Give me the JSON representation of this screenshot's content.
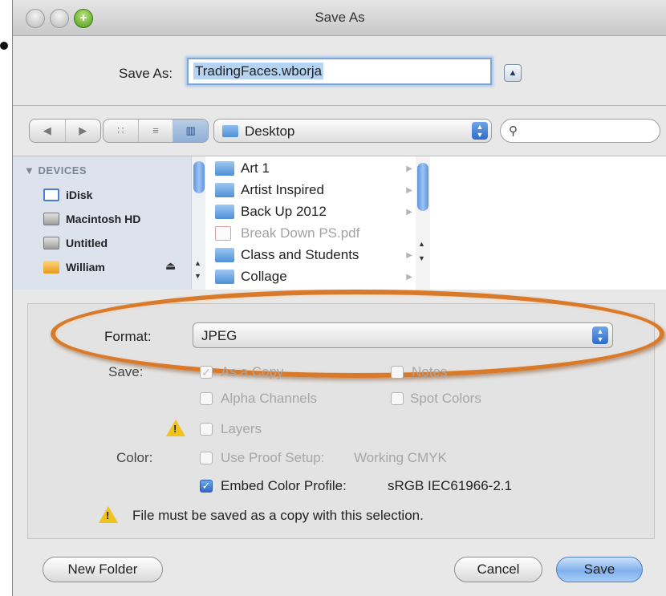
{
  "window": {
    "title": "Save As"
  },
  "save_as": {
    "label": "Save As:",
    "filename": "TradingFaces.wborja",
    "expand_glyph": "▲"
  },
  "toolbar": {
    "back_glyph": "◀",
    "forward_glyph": "▶",
    "view_icons_glyph": "∷",
    "view_list_glyph": "≡",
    "view_columns_glyph": "▥",
    "location": "Desktop",
    "search_glyph": "⚲",
    "search_value": ""
  },
  "sidebar": {
    "heading": "▼ DEVICES",
    "items": [
      {
        "label": "iDisk",
        "icon": "idisk-icon"
      },
      {
        "label": "Macintosh HD",
        "icon": "hard-drive-icon"
      },
      {
        "label": "Untitled",
        "icon": "hard-drive-icon"
      },
      {
        "label": "William",
        "icon": "home-folder-icon"
      }
    ],
    "eject_glyph": "⏏"
  },
  "files": [
    {
      "name": "Art 1",
      "type": "folder",
      "dimmed": false
    },
    {
      "name": "Artist Inspired",
      "type": "folder",
      "dimmed": false
    },
    {
      "name": "Back Up 2012",
      "type": "folder",
      "dimmed": false
    },
    {
      "name": "Break Down PS.pdf",
      "type": "pdf",
      "dimmed": true
    },
    {
      "name": "Class and Students",
      "type": "folder",
      "dimmed": false
    },
    {
      "name": "Collage",
      "type": "folder",
      "dimmed": false
    }
  ],
  "format": {
    "label": "Format:",
    "value": "JPEG",
    "highlight_color": "#d97a2a"
  },
  "options": {
    "save_label": "Save:",
    "as_a_copy": "As a Copy",
    "notes": "Notes",
    "alpha_channels": "Alpha Channels",
    "spot_colors": "Spot Colors",
    "layers": "Layers",
    "color_label": "Color:",
    "use_proof_setup": "Use Proof Setup:",
    "proof_profile": "Working CMYK",
    "embed_color_profile": "Embed Color Profile:",
    "embed_profile": "sRGB IEC61966-2.1",
    "embed_checked": true,
    "warning_message": "File must be saved as a copy with this selection."
  },
  "buttons": {
    "new_folder": "New Folder",
    "cancel": "Cancel",
    "save": "Save"
  }
}
